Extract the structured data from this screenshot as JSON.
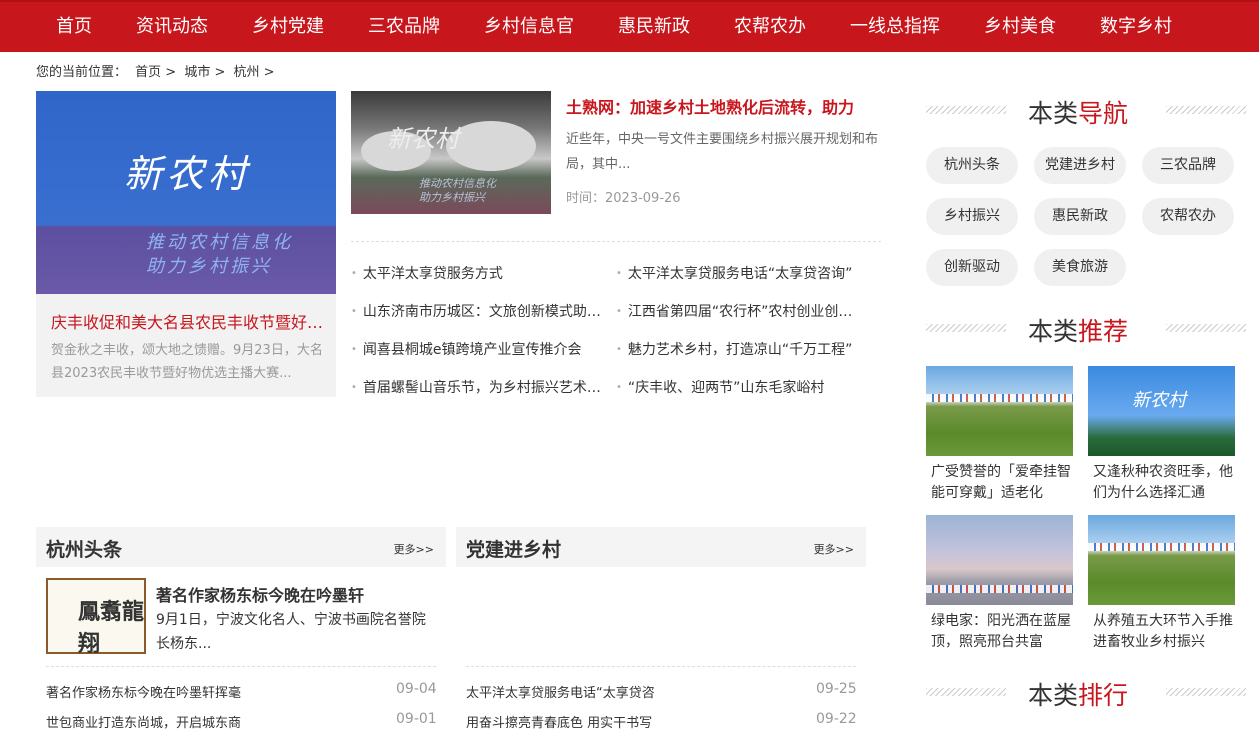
{
  "nav": [
    "首页",
    "资讯动态",
    "乡村党建",
    "三农品牌",
    "乡村信息官",
    "惠民新政",
    "农帮农办",
    "一线总指挥",
    "乡村美食",
    "数字乡村"
  ],
  "breadcrumb": {
    "prefix": "您的当前位置：",
    "items": [
      "首页 >",
      "城市 >",
      "杭州 >"
    ]
  },
  "feature": {
    "img_text1": "新农村",
    "img_text2a": "推动农村信息化",
    "img_text2b": "助力乡村振兴",
    "title": "庆丰收促和美大名县农民丰收节暨好物优选主播大赛",
    "desc": "贺金秋之丰收，颂大地之馈赠。9月23日，大名县2023农民丰收节暨好物优选主播大赛..."
  },
  "feature2": {
    "img_text1": "新农村",
    "img_text2a": "推动农村信息化",
    "img_text2b": "助力乡村振兴",
    "title": "土熟网：加速乡村土地熟化后流转，助力",
    "desc": "近些年，中央一号文件主要围绕乡村振兴展开规划和布局，其中...",
    "time": "时间：2023-09-26"
  },
  "newslist": [
    "太平洋太享贷服务方式",
    "太平洋太享贷服务电话“太享贷咨询”",
    "山东济南市历城区：文旅创新模式助力乡村振兴",
    "江西省第四届“农行杯”农村创业创新大赛",
    "闻喜县桐城e镇跨境产业宣传推介会",
    "魅力艺术乡村，打造凉山“千万工程”",
    "首届螺髻山音乐节，为乡村振兴艺术赋能",
    "“庆丰收、迎两节”山东毛家峪村"
  ],
  "sections": [
    {
      "title": "杭州头条",
      "more": "更多>>"
    },
    {
      "title": "党建进乡村",
      "more": "更多>>"
    }
  ],
  "hz": {
    "calligraphy": "鳳翥龍翔",
    "title": "著名作家杨东标今晚在吟墨轩",
    "desc": "9月1日，宁波文化名人、宁波书画院名誉院长杨东...",
    "list": [
      {
        "t": "著名作家杨东标今晚在吟墨轩挥毫",
        "d": "09-04"
      },
      {
        "t": "世包商业打造东尚城，开启城东商",
        "d": "09-01"
      }
    ]
  },
  "dj": {
    "list": [
      {
        "t": "太平洋太享贷服务电话“太享贷咨",
        "d": "09-25"
      },
      {
        "t": "用奋斗擦亮青春底色 用实干书写",
        "d": "09-22"
      }
    ]
  },
  "sidebar": {
    "nav_head": {
      "a": "本类",
      "b": "导航"
    },
    "tags": [
      "杭州头条",
      "党建进乡村",
      "三农品牌",
      "乡村振兴",
      "惠民新政",
      "农帮农办",
      "创新驱动",
      "美食旅游"
    ],
    "rec_head": {
      "a": "本类",
      "b": "推荐"
    },
    "recs": [
      {
        "text": "广受赞誉的「爱牵挂智能可穿戴」适老化"
      },
      {
        "text": "又逢秋种农资旺季，他们为什么选择汇通",
        "img_text": "新农村"
      },
      {
        "text": "绿电家：阳光洒在蓝屋顶，照亮邢台共富"
      },
      {
        "text": "从养殖五大环节入手推进畜牧业乡村振兴"
      }
    ],
    "rank_head": {
      "a": "本类",
      "b": "排行"
    }
  },
  "colors": {
    "brand": "#c8161d"
  }
}
